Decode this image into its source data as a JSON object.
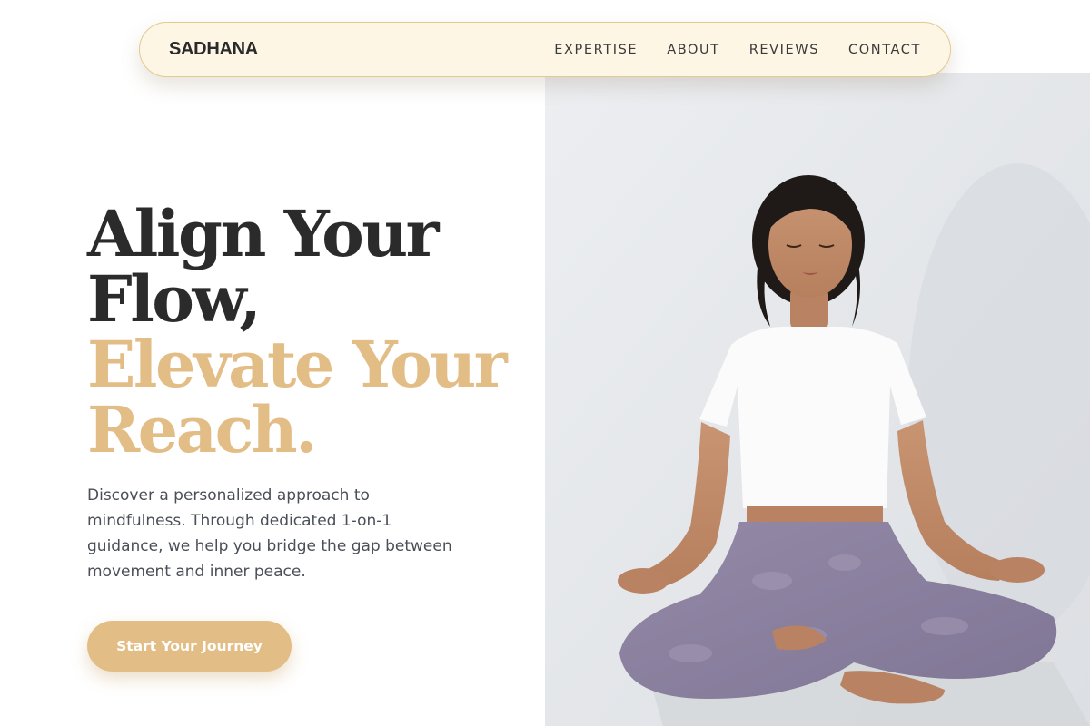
{
  "brand": {
    "name": "SADHANA"
  },
  "nav": {
    "items": [
      {
        "label": "EXPERTISE"
      },
      {
        "label": "ABOUT"
      },
      {
        "label": "REVIEWS"
      },
      {
        "label": "CONTACT"
      }
    ]
  },
  "hero": {
    "headline_line1": "Align Your",
    "headline_line2": "Flow,",
    "headline_line3": "Elevate Your",
    "headline_line4": "Reach.",
    "description": "Discover a personalized approach to mindfulness. Through dedicated 1-on-1 guidance, we help you bridge the gap between movement and inner peace.",
    "cta_label": "Start Your Journey"
  },
  "colors": {
    "accent": "#e3bd86",
    "nav_background": "#fdf6e4",
    "heading_dark": "#2b2b2b",
    "body_text": "#4a4e57"
  },
  "icons": [
    "woman-meditating-photo"
  ]
}
